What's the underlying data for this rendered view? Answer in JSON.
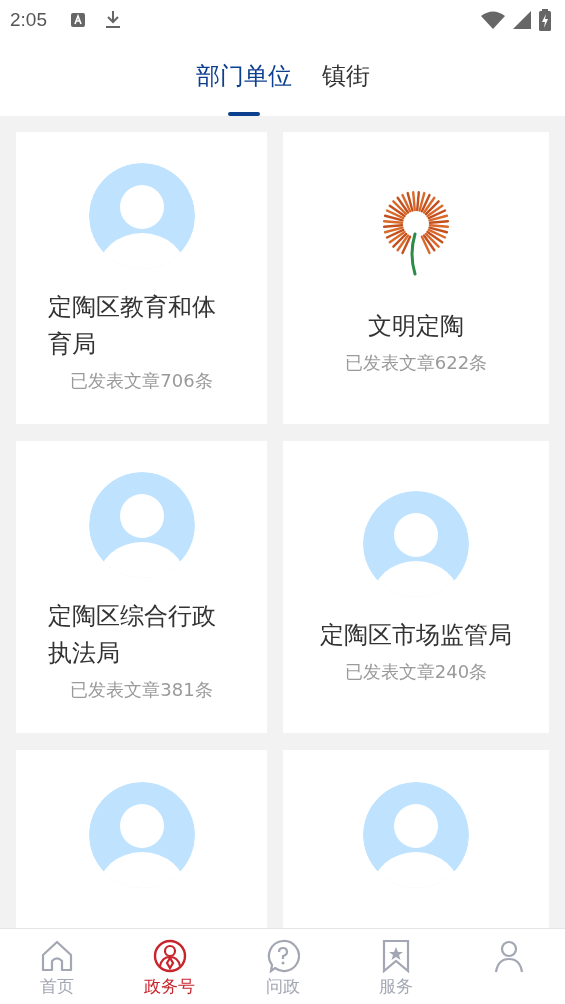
{
  "status_bar": {
    "time": "2:05"
  },
  "tabs": [
    {
      "label": "部门单位",
      "selected": true
    },
    {
      "label": "镇街",
      "selected": false
    }
  ],
  "cards": [
    {
      "kind": "avatar",
      "title": "定陶区教育和体育局",
      "count": "已发表文章706条"
    },
    {
      "kind": "logo",
      "title": "文明定陶",
      "count": "已发表文章622条"
    },
    {
      "kind": "avatar",
      "title": "定陶区综合行政执法局",
      "count": "已发表文章381条"
    },
    {
      "kind": "avatar",
      "title": "定陶区市场监管局",
      "count": "已发表文章240条"
    },
    {
      "kind": "avatar"
    },
    {
      "kind": "avatar"
    }
  ],
  "bottom_nav": [
    {
      "kind": "home",
      "label": "首页",
      "selected": false
    },
    {
      "kind": "gov",
      "label": "政务号",
      "selected": true
    },
    {
      "kind": "question",
      "label": "问政",
      "selected": false
    },
    {
      "kind": "bookmark",
      "label": "服务",
      "selected": false
    },
    {
      "kind": "person",
      "selected": false
    }
  ]
}
